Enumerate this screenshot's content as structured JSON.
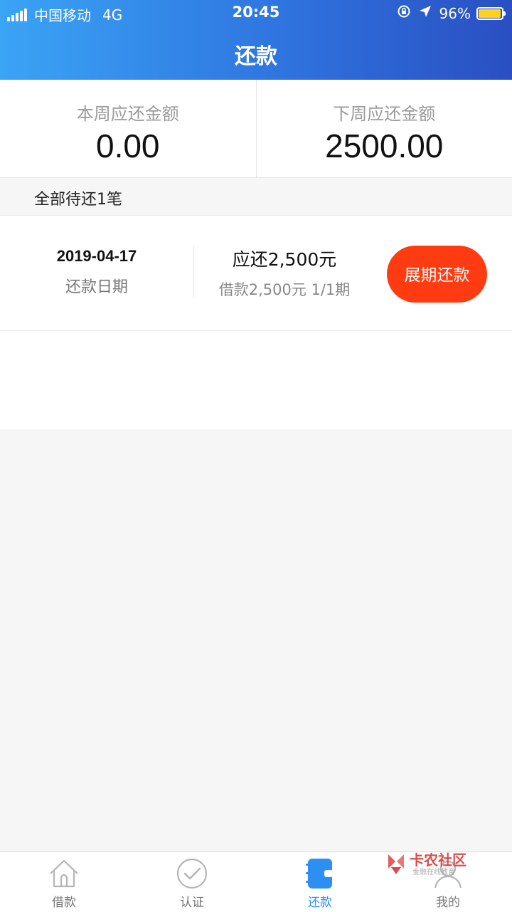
{
  "status_bar": {
    "carrier": "中国移动",
    "network": "4G",
    "time": "20:45",
    "battery_percent": "96%",
    "battery_level": 0.96,
    "battery_color": "#ffd21f"
  },
  "nav": {
    "title": "还款"
  },
  "summary": {
    "this_week_label": "本周应还金额",
    "this_week_value": "0.00",
    "next_week_label": "下周应还金额",
    "next_week_value": "2500.00"
  },
  "list": {
    "count_text": "全部待还1笔",
    "items": [
      {
        "date": "2019-04-17",
        "date_label": "还款日期",
        "amount_due": "应还2,500元",
        "loan_info": "借款2,500元 1/1期",
        "action_label": "展期还款"
      }
    ]
  },
  "colors": {
    "header_gradient_start": "#3aa4f5",
    "header_gradient_end": "#2a4fc2",
    "action_button": "#ff3b12",
    "tab_active": "#2d8ef3"
  },
  "tabbar": {
    "tabs": [
      {
        "label": "借款",
        "icon": "home-icon"
      },
      {
        "label": "认证",
        "icon": "check-circle-icon"
      },
      {
        "label": "还款",
        "icon": "wallet-icon",
        "active": true
      },
      {
        "label": "我的",
        "icon": "user-icon"
      }
    ]
  },
  "watermark": {
    "main": "卡农社区",
    "sub": "金融在线教育"
  }
}
